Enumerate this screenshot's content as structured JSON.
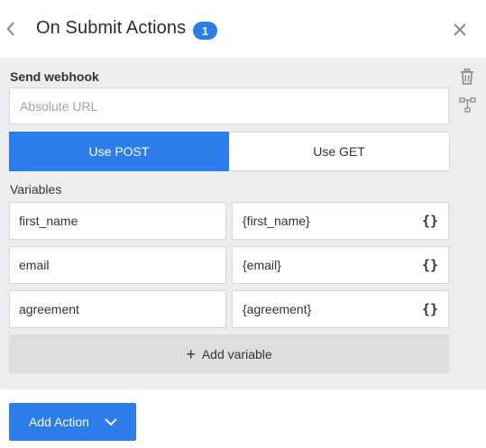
{
  "header": {
    "title": "On Submit Actions",
    "badge_count": "1",
    "back_icon": "chevron-left-icon",
    "close_icon": "close-icon"
  },
  "action": {
    "section_label": "Send webhook",
    "url_placeholder": "Absolute URL",
    "url_value": "",
    "method_post_label": "Use POST",
    "method_get_label": "Use GET",
    "selected_method": "POST",
    "variables_label": "Variables",
    "variables": [
      {
        "name": "first_name",
        "value": "{first_name}"
      },
      {
        "name": "email",
        "value": "{email}"
      },
      {
        "name": "agreement",
        "value": "{agreement}"
      }
    ],
    "braces_glyph": "{}",
    "add_variable_plus": "+",
    "add_variable_label": "Add variable",
    "delete_icon": "trash-icon",
    "flow_icon": "tree-icon"
  },
  "footer": {
    "add_action_label": "Add Action",
    "chevron_icon": "chevron-down-icon"
  },
  "colors": {
    "accent": "#2b7de9",
    "panel_bg": "#ebedf0",
    "add_variable_bg": "#dcdee1"
  }
}
